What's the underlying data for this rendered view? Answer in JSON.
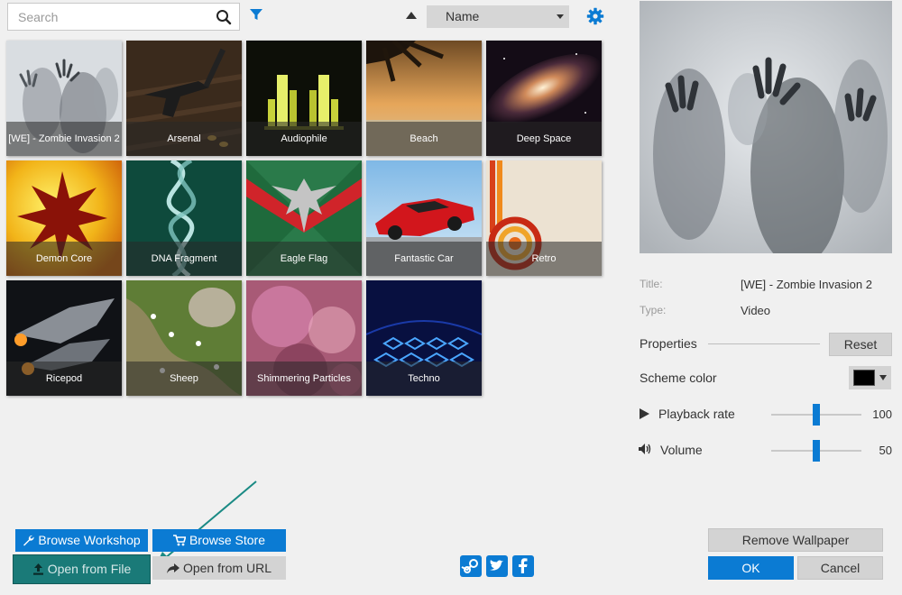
{
  "search": {
    "placeholder": "Search",
    "value": ""
  },
  "sort": {
    "selected": "Name",
    "direction": "ascending"
  },
  "icons": {
    "search": "search-icon",
    "filter": "filter-icon",
    "sort": "sort-ascending-icon",
    "settings": "gear-icon",
    "workshop": "wrench-icon",
    "store": "cart-icon",
    "file": "upload-icon",
    "url": "share-icon",
    "play": "play-icon",
    "volume": "speaker-icon"
  },
  "wallpapers": [
    {
      "title": "[WE] - Zombie Invasion 2",
      "selected": true
    },
    {
      "title": "Arsenal"
    },
    {
      "title": "Audiophile"
    },
    {
      "title": "Beach"
    },
    {
      "title": "Deep Space"
    },
    {
      "title": "Demon Core"
    },
    {
      "title": "DNA Fragment"
    },
    {
      "title": "Eagle Flag"
    },
    {
      "title": "Fantastic Car"
    },
    {
      "title": "Retro"
    },
    {
      "title": "Ricepod"
    },
    {
      "title": "Sheep"
    },
    {
      "title": "Shimmering Particles"
    },
    {
      "title": "Techno"
    }
  ],
  "details": {
    "title_label": "Title:",
    "title_value": "[WE] - Zombie Invasion 2",
    "type_label": "Type:",
    "type_value": "Video"
  },
  "properties": {
    "heading": "Properties",
    "reset_label": "Reset",
    "scheme_color_label": "Scheme color",
    "scheme_color": "#000000",
    "playback_rate": {
      "label": "Playback rate",
      "value": 100,
      "fraction": 0.5
    },
    "volume": {
      "label": "Volume",
      "value": 50,
      "fraction": 0.5
    }
  },
  "actions": {
    "browse_workshop": "Browse Workshop",
    "browse_store": "Browse Store",
    "open_file": "Open from File",
    "open_url": "Open from URL",
    "remove_wallpaper": "Remove Wallpaper",
    "ok": "OK",
    "cancel": "Cancel"
  },
  "social": [
    "steam-icon",
    "twitter-icon",
    "facebook-icon"
  ],
  "colors": {
    "accent": "#0b7bd3",
    "highlight_button": "#1a7a78",
    "annotation_arrow": "#1a8a84"
  }
}
